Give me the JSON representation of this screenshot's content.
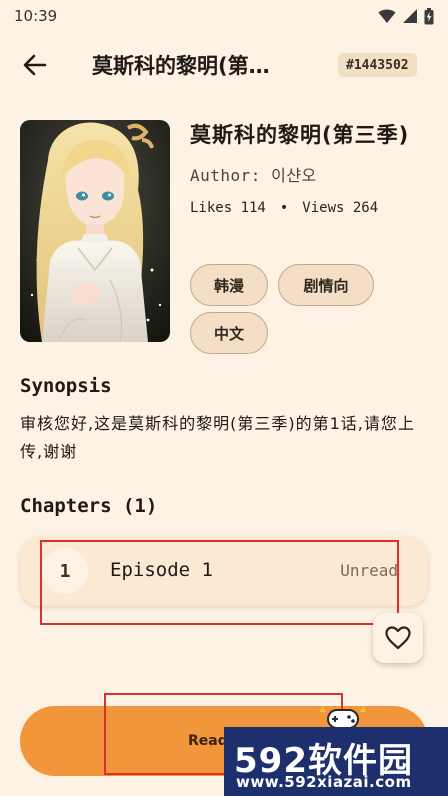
{
  "status_bar": {
    "time": "10:39"
  },
  "app_bar": {
    "title": "莫斯科的黎明(第…",
    "id_badge": "#1443502"
  },
  "comic": {
    "title": "莫斯科的黎明(第三季)",
    "author": "Author: 이샨오",
    "likes": "Likes 114",
    "separator": "•",
    "views": "Views 264",
    "tags": [
      "韩漫",
      "剧情向",
      "中文"
    ]
  },
  "synopsis": {
    "heading": "Synopsis",
    "text": "审核您好,这是莫斯科的黎明(第三季)的第1话,请您上传,谢谢"
  },
  "chapters": {
    "heading": "Chapters (1)",
    "items": [
      {
        "number": "1",
        "name": "Episode 1",
        "status": "Unread"
      }
    ]
  },
  "read_button": {
    "label": "Read"
  },
  "watermark": {
    "brand": "592软件园",
    "url": "www.592xiazai.com"
  },
  "colors": {
    "background": "#fdf2e3",
    "accent": "#f1963a",
    "tag_fill": "#f4dfc6",
    "annotation_red": "#d8312f",
    "watermark_bg": "#1e2f6e"
  }
}
